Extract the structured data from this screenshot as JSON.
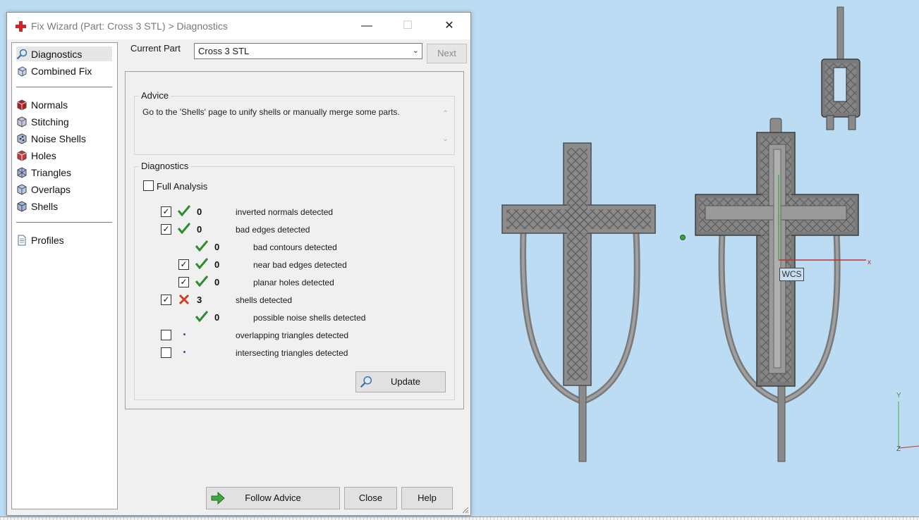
{
  "window": {
    "title": "Fix Wizard (Part: Cross 3 STL) > Diagnostics",
    "minimize": "—",
    "maximize": "☐",
    "close": "✕"
  },
  "nav": {
    "items": [
      {
        "label": "Diagnostics",
        "icon": "magnifier-icon"
      },
      {
        "label": "Combined Fix",
        "icon": "cube-icon"
      },
      {
        "label": "Normals",
        "icon": "normals-icon"
      },
      {
        "label": "Stitching",
        "icon": "stitching-icon"
      },
      {
        "label": "Noise Shells",
        "icon": "noise-shells-icon"
      },
      {
        "label": "Holes",
        "icon": "holes-icon"
      },
      {
        "label": "Triangles",
        "icon": "triangles-icon"
      },
      {
        "label": "Overlaps",
        "icon": "overlaps-icon"
      },
      {
        "label": "Shells",
        "icon": "shells-icon"
      },
      {
        "label": "Profiles",
        "icon": "document-icon"
      }
    ]
  },
  "top": {
    "current_part_label": "Current Part",
    "current_part_value": "Cross 3 STL",
    "next_label": "Next"
  },
  "advice": {
    "title": "Advice",
    "text": "Go to the 'Shells' page to unify shells or manually merge some parts."
  },
  "diagnostics": {
    "title": "Diagnostics",
    "full_analysis_label": "Full Analysis",
    "full_analysis_checked": false,
    "rows": [
      {
        "checked": true,
        "status": "ok",
        "count": "0",
        "text": "inverted normals detected"
      },
      {
        "checked": true,
        "status": "ok",
        "count": "0",
        "text": "bad edges detected"
      },
      {
        "checked": null,
        "status": "ok",
        "count": "0",
        "text": "bad contours detected"
      },
      {
        "checked": true,
        "status": "ok",
        "count": "0",
        "text": "near bad edges detected"
      },
      {
        "checked": true,
        "status": "ok",
        "count": "0",
        "text": "planar holes detected"
      },
      {
        "checked": true,
        "status": "error",
        "count": "3",
        "text": "shells detected"
      },
      {
        "checked": null,
        "status": "ok",
        "count": "0",
        "text": "possible noise shells detected"
      },
      {
        "checked": false,
        "status": "none",
        "count": "",
        "text": "overlapping triangles detected"
      },
      {
        "checked": false,
        "status": "none",
        "count": "",
        "text": "intersecting triangles detected"
      }
    ],
    "update_label": "Update"
  },
  "buttons": {
    "follow_advice": "Follow Advice",
    "close": "Close",
    "help": "Help"
  },
  "viewport": {
    "wcs_label": "WCS",
    "axis_x": "x",
    "axis_y": "Y",
    "axis_z": "Z"
  },
  "colors": {
    "viewport_bg": "#bcdcf4",
    "model_gray": "#8c8c8c",
    "ok_green": "#2e8b2e",
    "error_red": "#d23c28"
  }
}
